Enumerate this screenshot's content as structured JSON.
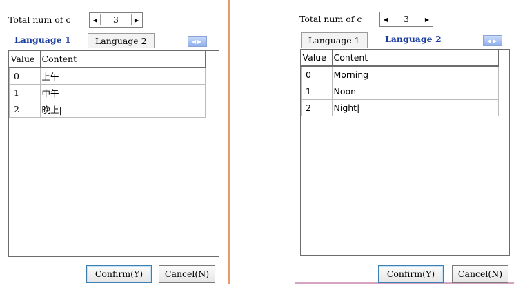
{
  "dialogs": [
    {
      "total_label": "Total num of c",
      "count": "3",
      "tabs": [
        "Language 1",
        "Language 2"
      ],
      "active_tab": 0,
      "columns": [
        "Value",
        "Content"
      ],
      "rows": [
        {
          "value": "0",
          "content": "上午"
        },
        {
          "value": "1",
          "content": "中午"
        },
        {
          "value": "2",
          "content": "晚上|"
        }
      ],
      "confirm": "Confirm(Y)",
      "cancel": "Cancel(N)"
    },
    {
      "total_label": "Total num of c",
      "count": "3",
      "tabs": [
        "Language 1",
        "Language 2"
      ],
      "active_tab": 1,
      "columns": [
        "Value",
        "Content"
      ],
      "rows": [
        {
          "value": "0",
          "content": "Morning"
        },
        {
          "value": "1",
          "content": "Noon"
        },
        {
          "value": "2",
          "content": "Night|"
        }
      ],
      "confirm": "Confirm(Y)",
      "cancel": "Cancel(N)"
    }
  ],
  "icons": {
    "spin_decrement": "triangle-left",
    "spin_increment": "triangle-right",
    "tab_scroll": "tab-scroll-arrows"
  },
  "colors": {
    "active_tab_text": "#1a3c9e",
    "left_panel_border": "#e69a6e",
    "right_panel_border": "#d6a3c2",
    "tab_scroll_fill": "#8fb0ec",
    "primary_button_border": "#3c7fb1"
  }
}
